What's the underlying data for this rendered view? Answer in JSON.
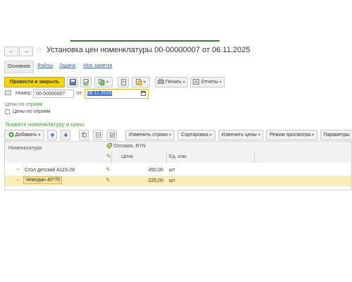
{
  "window": {
    "title": "Установка цен номенклатуры 00-00000007 от 06.11.2025",
    "back_glyph": "←",
    "forward_glyph": "→",
    "star_glyph": "☆"
  },
  "tabs": {
    "main": "Основное",
    "files": "Файлы",
    "tasks": "Задачи",
    "notes": "Мои заметки"
  },
  "toolbar": {
    "post_close": "Провести и закрыть",
    "print": "Печать",
    "reports": "Отчеты"
  },
  "form": {
    "number_label": "Номер:",
    "number_value": "00-00000007",
    "date_label": "от",
    "date_value": "06.11.2025",
    "series_link": "Цены по сериям",
    "series_checkbox_label": "Цены по сериям"
  },
  "section": {
    "title": "Укажите номенклатуру и цены"
  },
  "table_toolbar": {
    "add": "Добавить",
    "change_rows": "Изменить строки",
    "sort": "Сортировка",
    "change_prices": "Изменить цены",
    "view_mode": "Режим просмотра",
    "params": "Параметры"
  },
  "table": {
    "col_item": "Номенклатура",
    "price_type": "Оптовая, BYN",
    "col_price": "Цена",
    "col_unit": "Ед. изм.",
    "rows": [
      {
        "name": "Стол детский А115-28",
        "price": "450,00",
        "unit": "шт"
      },
      {
        "name": "Чемодан 40*70",
        "price": "220,00",
        "unit": "шт"
      }
    ]
  },
  "colors": {
    "accent_yellow": "#f5d50a",
    "link_green": "#4a9a3a",
    "selected_row": "#fbedb9",
    "date_selection": "#3d6fc8"
  }
}
